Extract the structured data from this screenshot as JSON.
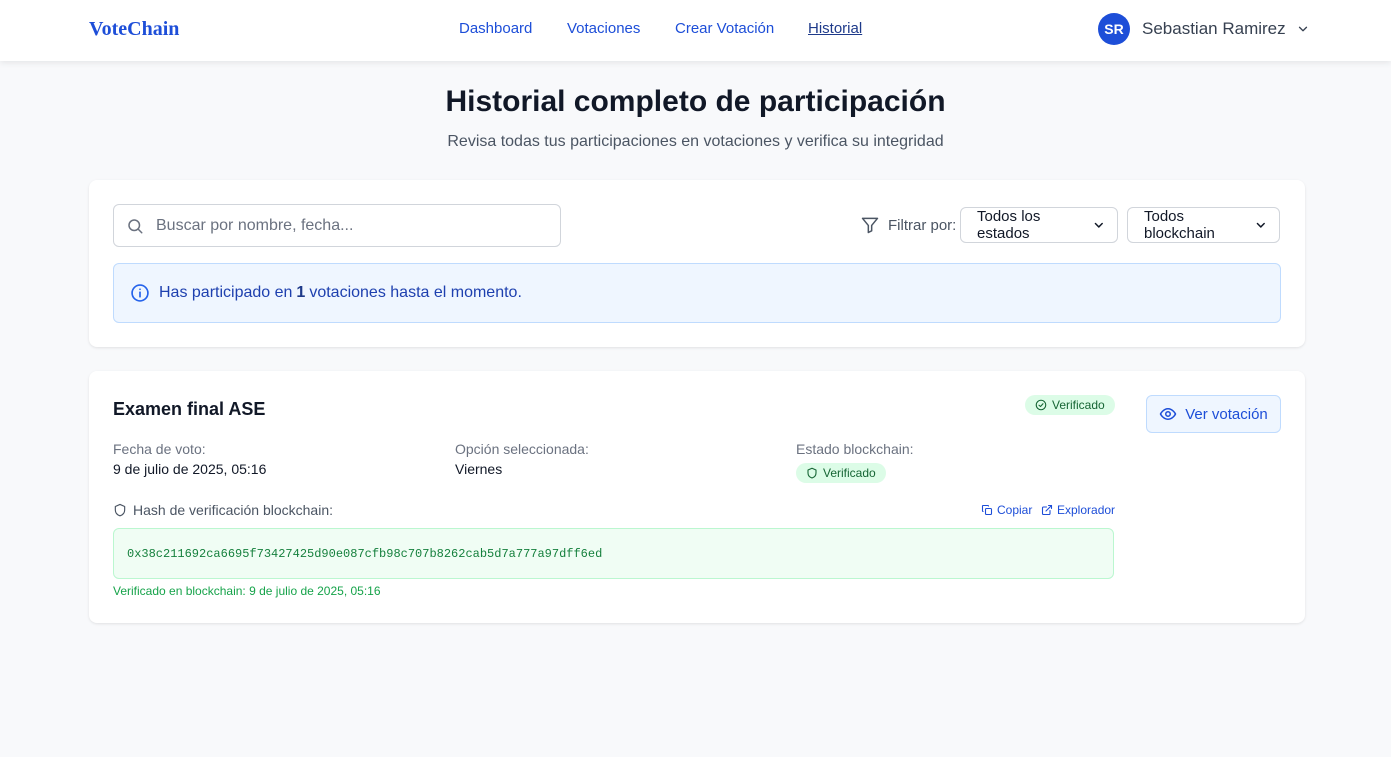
{
  "header": {
    "logo": "VoteChain",
    "nav": [
      {
        "label": "Dashboard"
      },
      {
        "label": "Votaciones"
      },
      {
        "label": "Crear Votación"
      },
      {
        "label": "Historial",
        "active": true
      }
    ],
    "user": {
      "initials": "SR",
      "name": "Sebastian Ramirez"
    }
  },
  "page": {
    "title": "Historial completo de participación",
    "subtitle": "Revisa todas tus participaciones en votaciones y verifica su integridad"
  },
  "filters": {
    "search_placeholder": "Buscar por nombre, fecha...",
    "filter_label": "Filtrar por:",
    "status_select": "Todos los estados",
    "blockchain_select": "Todos blockchain"
  },
  "info": {
    "prefix": "Has participado en",
    "count": "1",
    "suffix": "votaciones hasta el momento."
  },
  "vote": {
    "title": "Examen final ASE",
    "status_badge": "Verificado",
    "view_button": "Ver votación",
    "date_label": "Fecha de voto:",
    "date_value": "9 de julio de 2025, 05:16",
    "option_label": "Opción seleccionada:",
    "option_value": "Viernes",
    "blockchain_label": "Estado blockchain:",
    "blockchain_badge": "Verificado",
    "hash_label": "Hash de verificación blockchain:",
    "copy_label": "Copiar",
    "explorer_label": "Explorador",
    "hash": "0x38c211692ca6695f73427425d90e087cfb98c707b8262cab5d7a777a97dff6ed",
    "verified_at": "Verificado en blockchain: 9 de julio de 2025, 05:16"
  },
  "colors": {
    "accent": "#1d4ed8",
    "background": "#f8f9fb",
    "success_bg": "#dcfce7",
    "success_text": "#166534",
    "info_bg": "#eff6ff"
  }
}
